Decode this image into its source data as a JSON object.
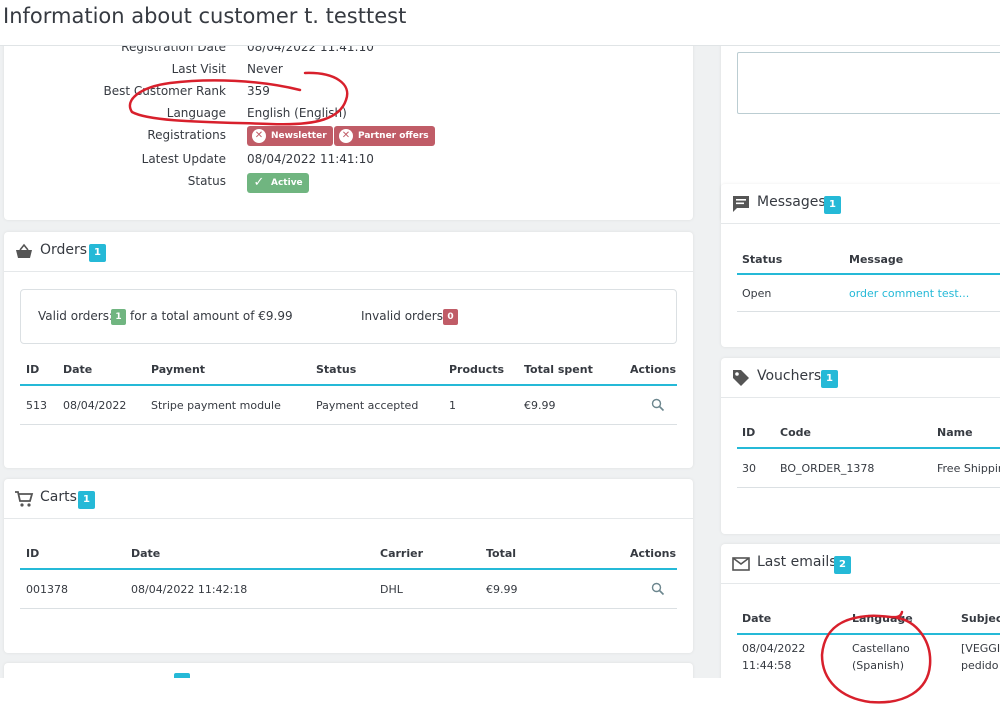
{
  "page_title": "Information about customer t. testtest",
  "profile": {
    "rows": [
      {
        "label": "Registration Date",
        "value": "08/04/2022 11:41:10"
      },
      {
        "label": "Last Visit",
        "value": "Never"
      },
      {
        "label": "Best Customer Rank",
        "value": "359"
      },
      {
        "label": "Language",
        "value": "English (English)"
      },
      {
        "label": "Registrations",
        "value": ""
      },
      {
        "label": "Latest Update",
        "value": "08/04/2022 11:41:10"
      },
      {
        "label": "Status",
        "value": ""
      }
    ],
    "newsletter_tag": "Newsletter",
    "partner_tag": "Partner offers",
    "status_tag": "Active"
  },
  "orders": {
    "title": "Orders",
    "count": "1",
    "valid_label": "Valid orders:",
    "valid_count": "1",
    "valid_total": "for a total amount of €9.99",
    "invalid_label": "Invalid orders:",
    "invalid_count": "0",
    "columns": [
      "ID",
      "Date",
      "Payment",
      "Status",
      "Products",
      "Total spent",
      "Actions"
    ],
    "rows": [
      {
        "id": "513",
        "date": "08/04/2022",
        "payment": "Stripe payment module",
        "status": "Payment accepted",
        "products": "1",
        "total": "€9.99"
      }
    ]
  },
  "carts": {
    "title": "Carts",
    "count": "1",
    "columns": [
      "ID",
      "Date",
      "Carrier",
      "Total",
      "Actions"
    ],
    "rows": [
      {
        "id": "001378",
        "date": "08/04/2022 11:42:18",
        "carrier": "DHL",
        "total": "€9.99"
      }
    ]
  },
  "messages": {
    "title": "Messages",
    "count": "1",
    "columns": [
      "Status",
      "Message"
    ],
    "rows": [
      {
        "status": "Open",
        "message": "order comment test..."
      }
    ]
  },
  "vouchers": {
    "title": "Vouchers",
    "count": "1",
    "columns": [
      "ID",
      "Code",
      "Name"
    ],
    "rows": [
      {
        "id": "30",
        "code": "BO_ORDER_1378",
        "name": "Free Shipping"
      }
    ]
  },
  "emails": {
    "title": "Last emails",
    "count": "2",
    "columns": [
      "Date",
      "Language",
      "Subject"
    ],
    "rows": [
      {
        "date_1": "08/04/2022",
        "date_2": "11:44:58",
        "lang_1": "Castellano",
        "lang_2": "(Spanish)",
        "subj_1": "[VEGGIE",
        "subj_2": "pedido"
      }
    ]
  },
  "colors": {
    "accent": "#25b9d7",
    "danger": "#c05c67",
    "success": "#70b580",
    "annotation": "#d8202c"
  }
}
